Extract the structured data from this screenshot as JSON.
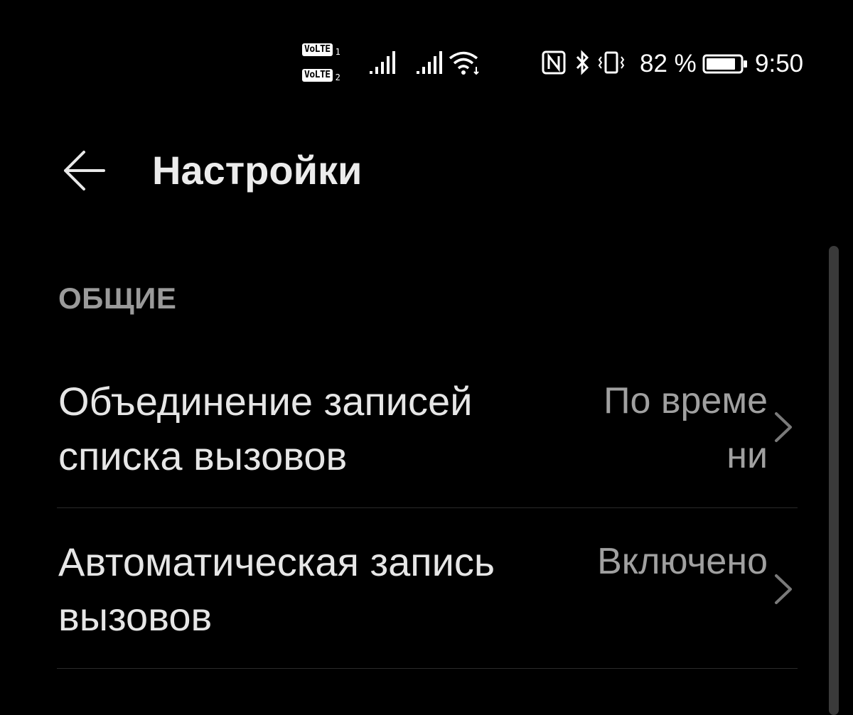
{
  "status_bar": {
    "volte_label": "VoLTE",
    "sim1": "1",
    "sim2": "2",
    "battery_percent": "82 %",
    "time": "9:50",
    "icons": [
      "signal-sim1-icon",
      "signal-sim2-icon",
      "wifi-icon",
      "nfc-icon",
      "bluetooth-icon",
      "vibrate-icon",
      "battery-icon"
    ]
  },
  "app_bar": {
    "back_icon": "arrow-left-icon",
    "title": "Настройки"
  },
  "section": {
    "header": "ОБЩИЕ"
  },
  "items": [
    {
      "title": "Объединение записей списка вызовов",
      "value": "По времени"
    },
    {
      "title": "Автоматическая запись вызовов",
      "value": "Включено"
    }
  ],
  "colors": {
    "background": "#000000",
    "title": "#ececec",
    "item_text": "#e6e6e6",
    "secondary_text": "#a0a0a0",
    "section_header": "#9a9a9a",
    "divider": "#2a2a2a"
  }
}
